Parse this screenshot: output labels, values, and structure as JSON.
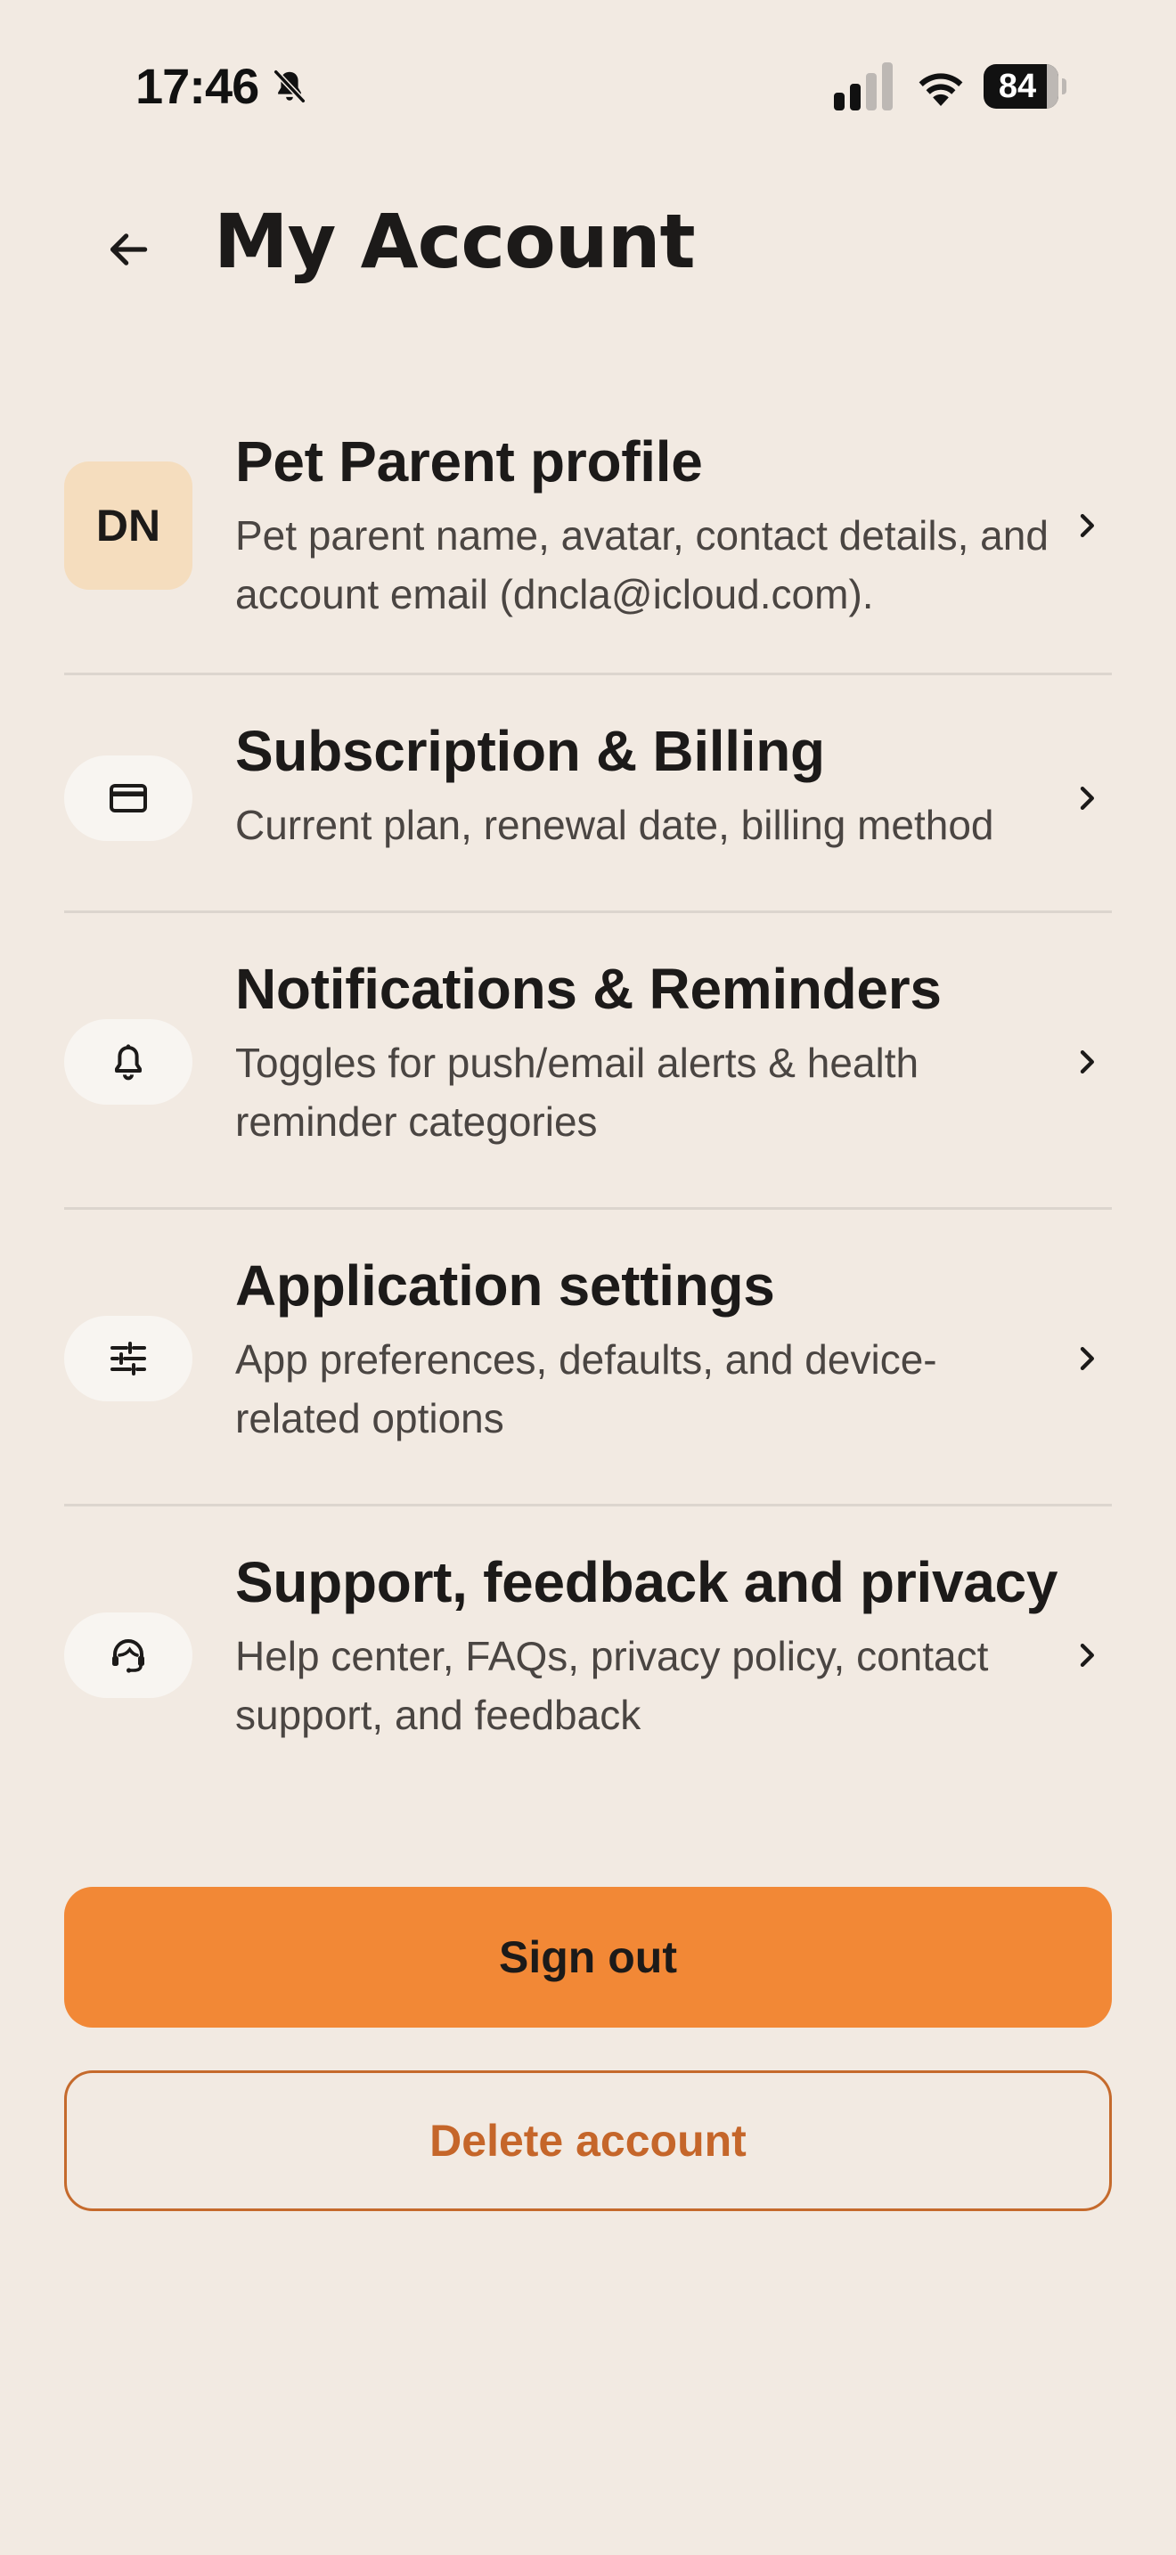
{
  "status_bar": {
    "time": "17:46",
    "battery": "84",
    "icons": [
      "bell-muted-icon",
      "signal-icon",
      "wifi-icon",
      "battery-icon"
    ]
  },
  "header": {
    "title": "My Account",
    "back_icon": "arrow-left-icon"
  },
  "menu": {
    "items": [
      {
        "title": "Pet Parent profile",
        "description": "Pet parent name, avatar, contact details, and account email (dncla@icloud.com).",
        "avatar_initials": "DN",
        "icon": "avatar"
      },
      {
        "title": "Subscription & Billing",
        "description": "Current plan, renewal date, billing method",
        "icon": "credit-card-icon"
      },
      {
        "title": "Notifications & Reminders",
        "description": "Toggles for push/email alerts & health reminder categories",
        "icon": "bell-icon"
      },
      {
        "title": "Application settings",
        "description": "App preferences, defaults, and device-related options",
        "icon": "sliders-icon"
      },
      {
        "title": "Support, feedback and privacy",
        "description": "Help center, FAQs, privacy policy, contact support, and feedback",
        "icon": "support-agent-icon"
      }
    ],
    "chevron_icon": "chevron-right-icon"
  },
  "actions": {
    "sign_out": "Sign out",
    "delete_account": "Delete account"
  },
  "colors": {
    "background": "#F2EAE2",
    "accent": "#F28836",
    "danger_text": "#C5662A",
    "avatar_bg": "#F5DDBE",
    "icon_pill_bg": "#F8F5F1"
  }
}
